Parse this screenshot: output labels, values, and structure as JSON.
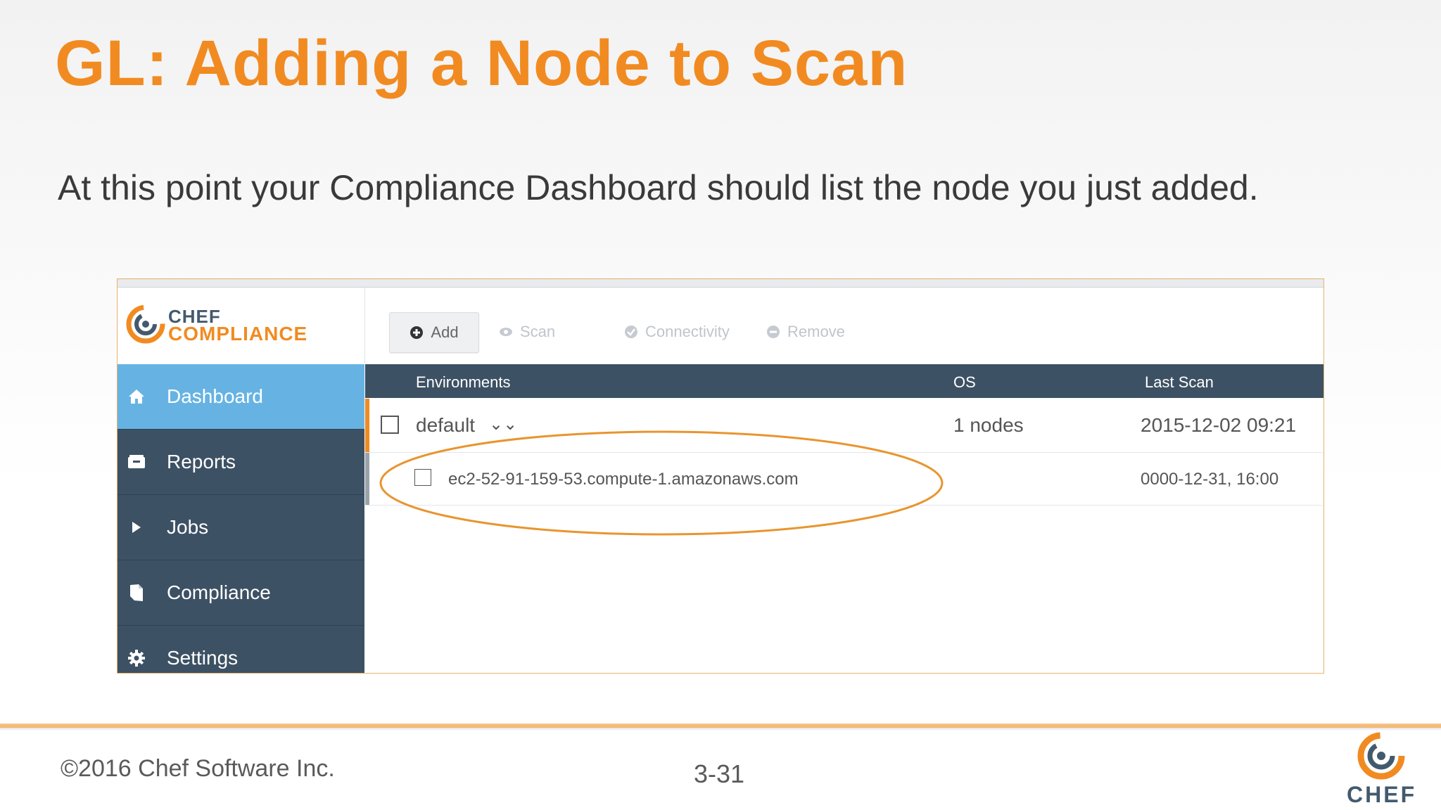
{
  "slide": {
    "title": "GL: Adding a Node to Scan",
    "subtitle": "At this point your Compliance Dashboard should list the node you just added.",
    "copyright": "©2016 Chef Software Inc.",
    "page_number": "3-31",
    "footer_logo_text": "CHEF"
  },
  "app": {
    "logo_line1": "CHEF",
    "logo_line2": "COMPLIANCE",
    "toolbar": {
      "add": "Add",
      "scan": "Scan",
      "connectivity": "Connectivity",
      "remove": "Remove"
    },
    "sidebar": [
      {
        "label": "Dashboard",
        "icon": "home-icon",
        "active": true
      },
      {
        "label": "Reports",
        "icon": "inbox-icon",
        "active": false
      },
      {
        "label": "Jobs",
        "icon": "play-icon",
        "active": false
      },
      {
        "label": "Compliance",
        "icon": "shield-icon",
        "active": false
      },
      {
        "label": "Settings",
        "icon": "gear-icon",
        "active": false
      }
    ],
    "table": {
      "headers": {
        "environments": "Environments",
        "os": "OS",
        "last_scan": "Last Scan"
      },
      "rows": [
        {
          "name": "default",
          "os": "1 nodes",
          "last_scan": "2015-12-02 09:21"
        },
        {
          "name": "ec2-52-91-159-53.compute-1.amazonaws.com",
          "os": "",
          "last_scan": "0000-12-31, 16:00"
        }
      ]
    }
  },
  "colors": {
    "accent_orange": "#f18b21",
    "sidebar_bg": "#3d5164",
    "sidebar_active": "#66b3e3"
  }
}
